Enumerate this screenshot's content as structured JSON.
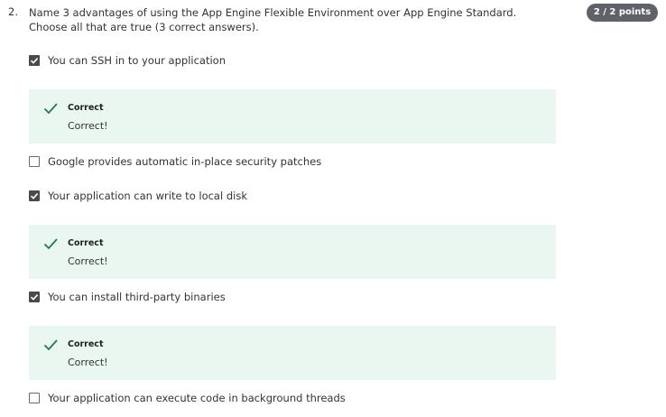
{
  "question": {
    "number": "2.",
    "text": "Name 3 advantages of using the App Engine Flexible Environment over App Engine Standard. Choose all that are true (3 correct answers).",
    "points": "2 / 2 points"
  },
  "options": [
    {
      "label": "You can SSH in to your application",
      "checked": true
    },
    {
      "label": "Google provides automatic in-place security patches",
      "checked": false
    },
    {
      "label": "Your application can write to local disk",
      "checked": true
    },
    {
      "label": "You can install third-party binaries",
      "checked": true
    },
    {
      "label": "Your application can execute code in background threads",
      "checked": false
    }
  ],
  "feedback": [
    {
      "title": "Correct",
      "text": "Correct!"
    },
    {
      "title": "Correct",
      "text": "Correct!"
    },
    {
      "title": "Correct",
      "text": "Correct!"
    }
  ],
  "colors": {
    "feedback_bg": "#eaf6f0",
    "check_green": "#1e7b4e",
    "checkbox_fill": "#4a4a4a",
    "badge_bg": "#5f6368"
  }
}
